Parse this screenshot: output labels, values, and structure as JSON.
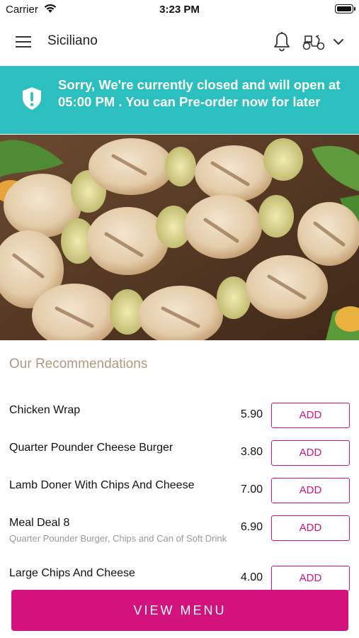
{
  "status_bar": {
    "carrier": "Carrier",
    "time": "3:23 PM"
  },
  "header": {
    "restaurant_name": "Siciliano"
  },
  "notice": {
    "message": "Sorry, We're currently closed and will open at 05:00 PM . You can Pre-order now for later"
  },
  "recommendations": {
    "title": "Our Recommendations",
    "items": [
      {
        "name": "Chicken Wrap",
        "description": "",
        "price": "5.90",
        "add_label": "ADD"
      },
      {
        "name": "Quarter Pounder Cheese Burger",
        "description": "",
        "price": "3.80",
        "add_label": "ADD"
      },
      {
        "name": "Lamb Doner With Chips And Cheese",
        "description": "",
        "price": "7.00",
        "add_label": "ADD"
      },
      {
        "name": "Meal Deal 8",
        "description": "Quarter Pounder Burger, Chips and Can of Soft Drink",
        "price": "6.90",
        "add_label": "ADD"
      },
      {
        "name": "Large Chips And Cheese",
        "description": "",
        "price": "4.00",
        "add_label": "ADD"
      }
    ]
  },
  "footer": {
    "view_menu_label": "VIEW MENU"
  },
  "colors": {
    "accent": "#d4127e",
    "notice_bg": "#2bbfc0",
    "section_title": "#b09a80"
  },
  "icons": [
    "wifi-icon",
    "battery-icon",
    "hamburger-menu-icon",
    "bell-icon",
    "scooter-icon",
    "chevron-down-icon",
    "shield-alert-icon"
  ]
}
